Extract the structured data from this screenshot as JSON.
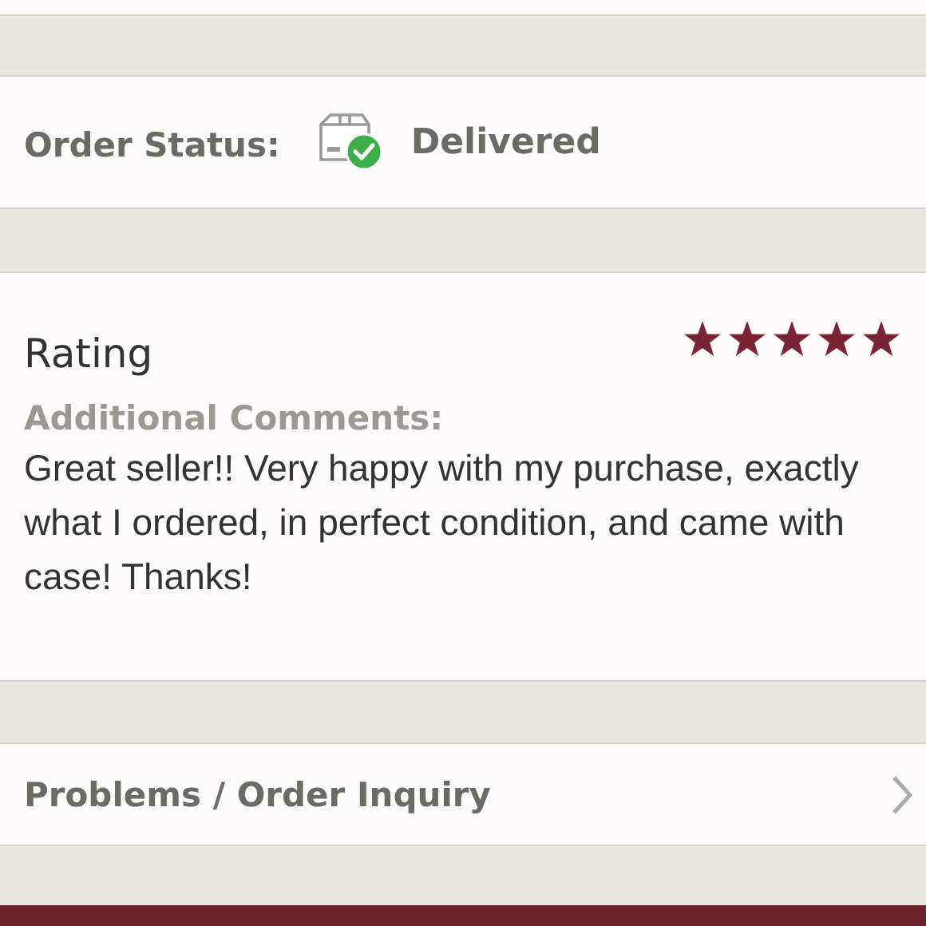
{
  "order_status": {
    "label": "Order Status:",
    "value": "Delivered"
  },
  "rating": {
    "title": "Rating",
    "stars": 5,
    "comments_label": "Additional Comments:",
    "comments": "Great seller!! Very happy with my purchase, exactly what I ordered, in perfect condition, and came with case! Thanks!"
  },
  "inquiry": {
    "label": "Problems / Order Inquiry"
  }
}
